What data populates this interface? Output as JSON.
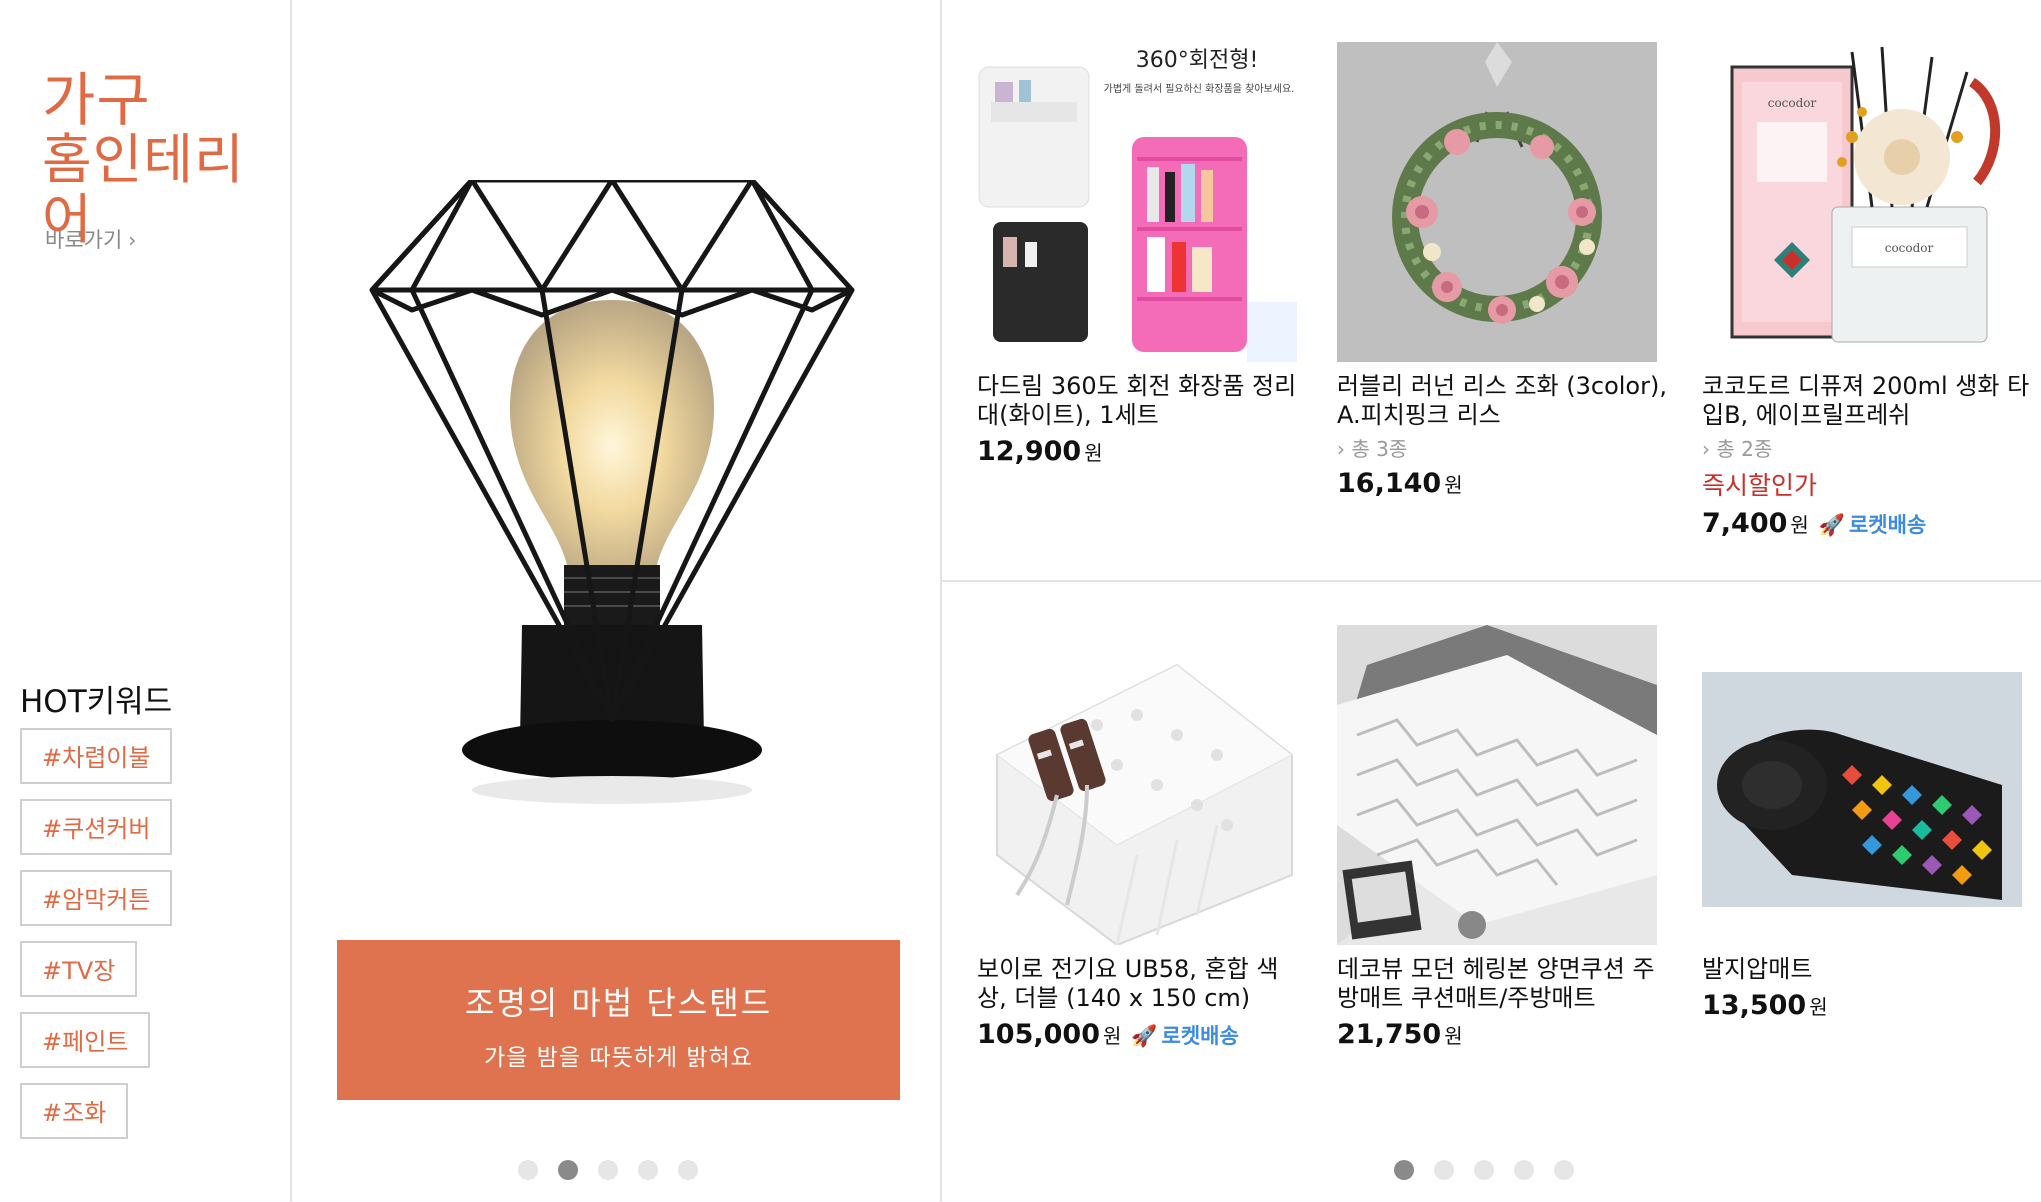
{
  "category": {
    "line1": "가구",
    "line2": "홈인테리어",
    "goto_label": "바로가기"
  },
  "hot": {
    "title": "HOT키워드",
    "keywords": [
      "#차렵이불",
      "#쿠션커버",
      "#암막커튼",
      "#TV장",
      "#페인트",
      "#조화"
    ]
  },
  "banner": {
    "title": "조명의 마법 단스탠드",
    "subtitle": "가을 밤을 따뜻하게 밝혀요",
    "slide_count": 5,
    "active_slide": 2
  },
  "products": [
    {
      "name": "다드림 360도 회전 화장품 정리대(화이트), 1세트",
      "price": "12,900",
      "currency": "원",
      "image_text": {
        "headline": "360°회전형!",
        "sub": "가볍게 돌려서 필요하신 화장품을 찾아보세요."
      }
    },
    {
      "name": "러블리 러넌 리스 조화 (3color), A.피치핑크 리스",
      "variants": "총 3종",
      "price": "16,140",
      "currency": "원"
    },
    {
      "name": "코코도르 디퓨져 200ml 생화 타입B, 에이프릴프레쉬",
      "variants": "총 2종",
      "instant": "즉시할인가",
      "price": "7,400",
      "currency": "원",
      "rocket": "로켓배송",
      "image_text": {
        "brand": "cocodor"
      }
    },
    {
      "name": "보이로 전기요 UB58, 혼합 색상, 더블 (140 x 150 cm)",
      "price": "105,000",
      "currency": "원",
      "rocket": "로켓배송"
    },
    {
      "name": "데코뷰 모던 헤링본 양면쿠션 주방매트 쿠션매트/주방매트",
      "price": "21,750",
      "currency": "원"
    },
    {
      "name": "발지압매트",
      "price": "13,500",
      "currency": "원"
    }
  ],
  "products_pager": {
    "slide_count": 5,
    "active_slide": 1
  },
  "colors": {
    "accent": "#e06a43",
    "banner": "#e0734f",
    "rocket": "#3d8be0",
    "instant": "#c9302c"
  }
}
